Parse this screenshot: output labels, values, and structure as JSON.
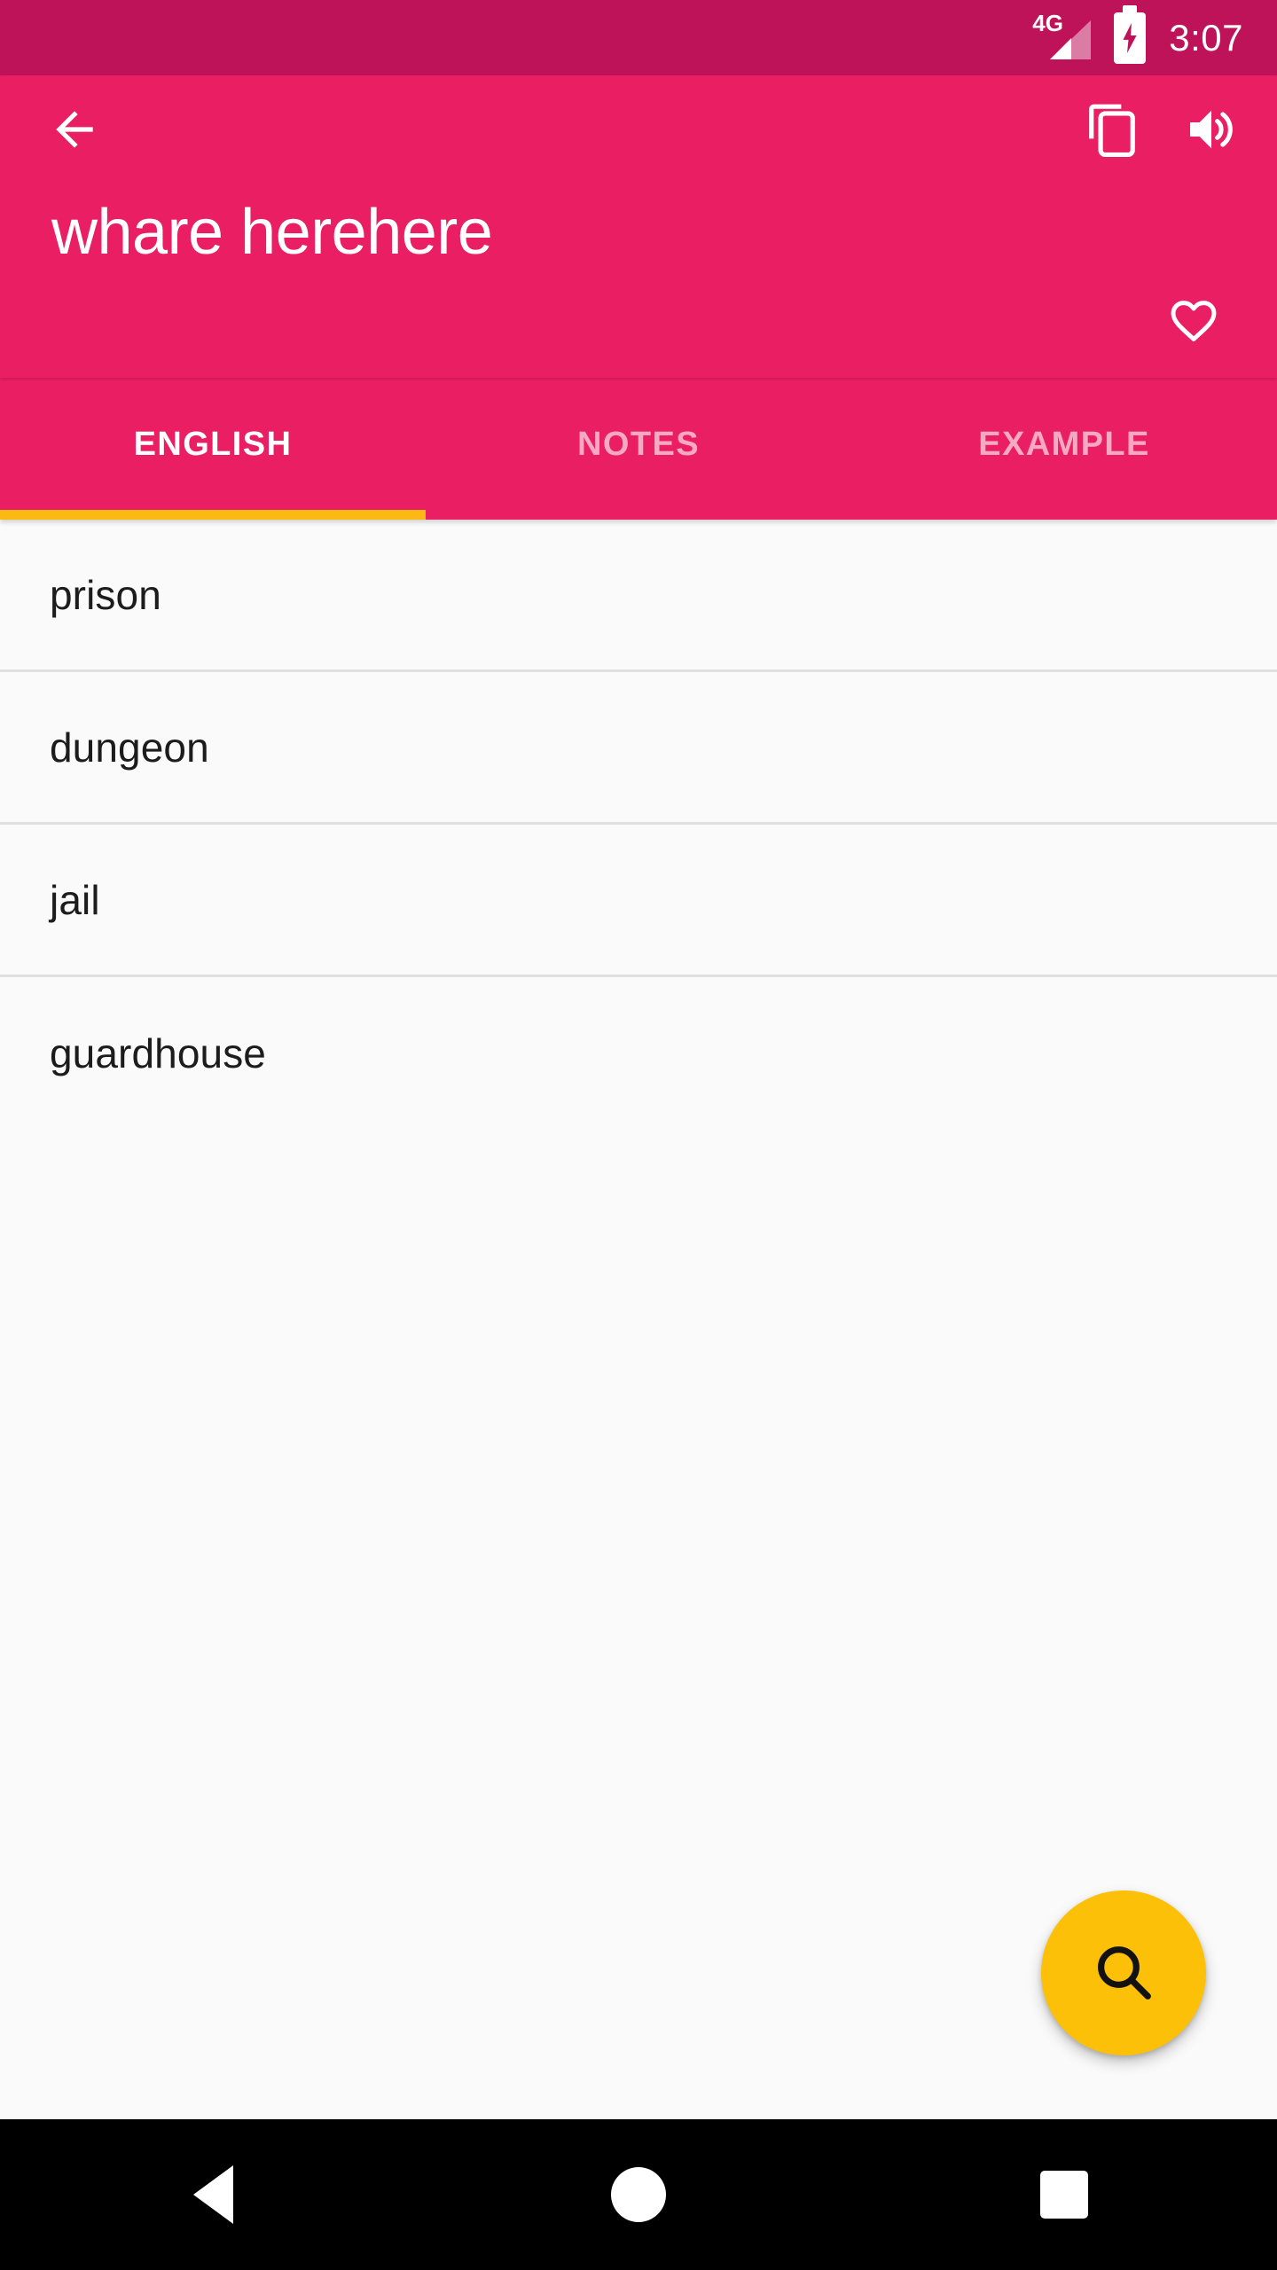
{
  "status_bar": {
    "network_label": "4G",
    "battery_state": "charging",
    "time": "3:07",
    "background_color": "#BE1259"
  },
  "app_bar": {
    "background_color": "#E91E63",
    "back_label": "Back",
    "title": "whare herehere",
    "copy_label": "Copy",
    "speak_label": "Pronounce",
    "favorite_label": "Favorite",
    "favorite_active": false
  },
  "tabs": {
    "indicator_color": "#FCB813",
    "active_index": 0,
    "items": [
      {
        "label": "ENGLISH"
      },
      {
        "label": "NOTES"
      },
      {
        "label": "EXAMPLE"
      }
    ]
  },
  "meanings": [
    {
      "text": "prison"
    },
    {
      "text": "dungeon"
    },
    {
      "text": "jail"
    },
    {
      "text": "guardhouse"
    }
  ],
  "fab": {
    "label": "Search",
    "icon": "search-icon",
    "background_color": "#FCC008"
  },
  "nav_bar": {
    "back_label": "Back",
    "home_label": "Home",
    "recents_label": "Recents"
  }
}
